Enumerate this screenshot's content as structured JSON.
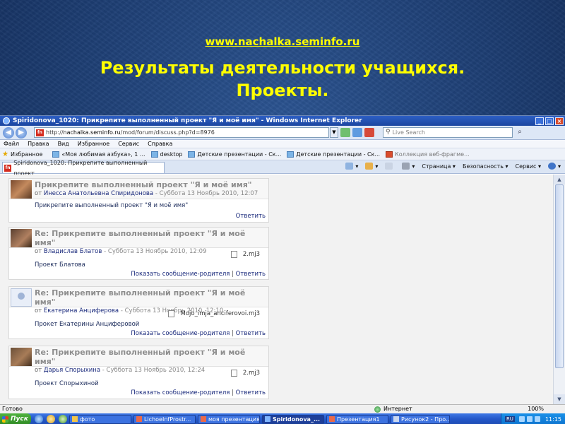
{
  "slide": {
    "url": "www.nachalka.seminfo.ru",
    "heading_line1": "Результаты деятельности учащихся.",
    "heading_line2": "Проекты."
  },
  "browser": {
    "window_title": "Spiridonova_1020: Прикрепите выполненный проект \"Я и моё имя\" - Windows Internet Explorer",
    "address_prefix": "http://",
    "address_host": "nachalka.seminfo.ru",
    "address_path": "/mod/forum/discuss.php?d=8976",
    "search_placeholder": "Live Search",
    "menu": [
      "Файл",
      "Правка",
      "Вид",
      "Избранное",
      "Сервис",
      "Справка"
    ],
    "favorites_label": "Избранное",
    "favorites": [
      {
        "label": "«Моя любимая азбука», 1 ...",
        "dim": false
      },
      {
        "label": "desktop",
        "dim": false
      },
      {
        "label": "Детские презентации - Ск...",
        "dim": false
      },
      {
        "label": "Детские презентации - Ск...",
        "dim": false
      },
      {
        "label": "Коллекция веб-фрагме...",
        "dim": true
      }
    ],
    "tab_label": "Spiridonova_1020: Прикрепите выполненный проект...",
    "tab_tools": [
      "Страница",
      "Безопасность",
      "Сервис"
    ],
    "status_text": "Готово",
    "status_zone": "Интернет",
    "status_zoom": "100%"
  },
  "posts": [
    {
      "subject": "Прикрепите выполненный проект \"Я и моё имя\"",
      "by": "от",
      "author": "Инесса Анатольевна Спиридонова",
      "date": "- Суббота 13 Ноябрь 2010, 12:07",
      "attachment": "",
      "text": "Прикрепите выполненный проект \"Я и моё имя\"",
      "parent_link": "",
      "reply_link": "Ответить"
    },
    {
      "subject": "Re: Прикрепите выполненный проект \"Я и моё имя\"",
      "by": "от",
      "author": "Владислав Блатов",
      "date": "- Суббота 13 Ноябрь 2010, 12:09",
      "attachment": "2.mj3",
      "text": "Проект Блатова",
      "parent_link": "Показать сообщение-родителя",
      "reply_link": "Ответить"
    },
    {
      "subject": "Re: Прикрепите выполненный проект \"Я и моё имя\"",
      "by": "от",
      "author": "Екатерина Анциферова",
      "date": "- Суббота 13 Ноябрь 2010, 12:10",
      "attachment": "Mojo_imja_anciferovoi.mj3",
      "text": "Прокет Екатерины Анциферовой",
      "parent_link": "Показать сообщение-родителя",
      "reply_link": "Ответить"
    },
    {
      "subject": "Re: Прикрепите выполненный проект \"Я и моё имя\"",
      "by": "от",
      "author": "Дарья Спорыхина",
      "date": "- Суббота 13 Ноябрь 2010, 12:24",
      "attachment": "2.mj3",
      "text": "Проект Спорыхиной",
      "parent_link": "Показать сообщение-родителя",
      "reply_link": "Ответить"
    }
  ],
  "taskbar": {
    "start": "Пуск",
    "tasks": [
      {
        "label": "фото",
        "active": false
      },
      {
        "label": "LichoeInfProstr...",
        "active": false
      },
      {
        "label": "моя презентация",
        "active": false
      },
      {
        "label": "Spiridonova_...",
        "active": true
      },
      {
        "label": "Презентация1",
        "active": false
      },
      {
        "label": "Рисунок2 - Про...",
        "active": false
      }
    ],
    "lang": "RU",
    "clock": "11:15"
  }
}
